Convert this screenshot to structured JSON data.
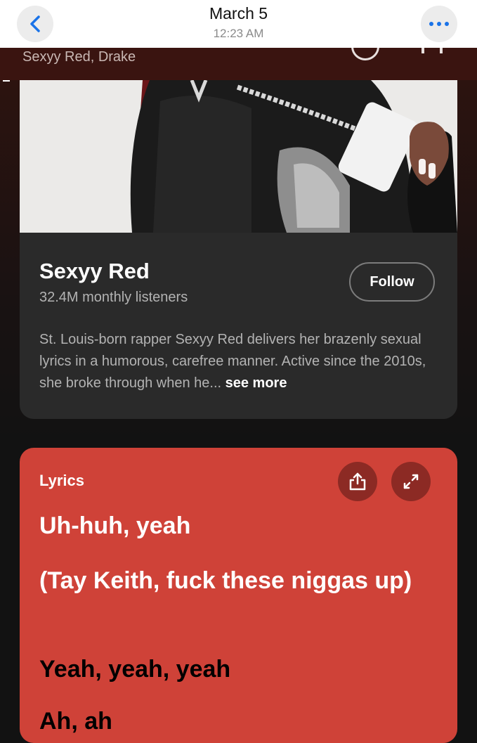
{
  "header": {
    "date": "March 5",
    "time": "12:23 AM",
    "back_icon": "chevron-left-icon",
    "more_icon": "ellipsis-icon"
  },
  "now_playing": {
    "artists": "Sexyy Red, Drake"
  },
  "artist": {
    "name": "Sexyy Red",
    "monthly_listeners": "32.4M monthly listeners",
    "follow_label": "Follow",
    "bio": "St. Louis-born rapper Sexyy Red delivers her brazenly sexual lyrics in a humorous, carefree manner. Active since the 2010s, she broke through when he...",
    "see_more_label": "see more"
  },
  "lyrics": {
    "label": "Lyrics",
    "lines": [
      "Uh-huh, yeah",
      "(Tay Keith, fuck these niggas up)",
      "Yeah, yeah, yeah",
      "Ah, ah"
    ],
    "card_color": "#cf4238"
  },
  "colors": {
    "accent_blue": "#1a73e8",
    "card_bg": "#2a2a2a",
    "page_bg": "#121212"
  }
}
